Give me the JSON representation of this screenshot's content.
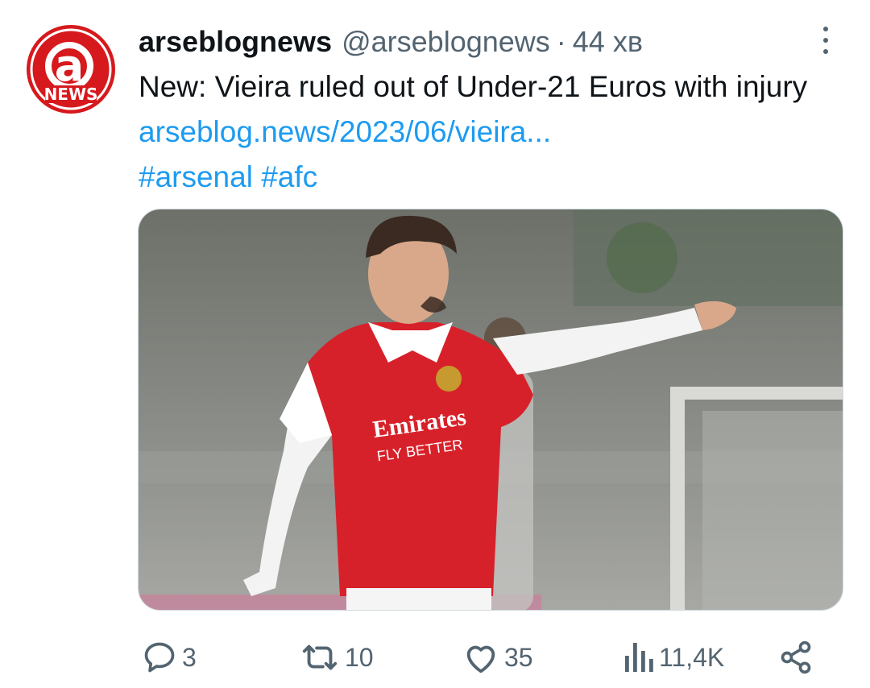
{
  "tweet": {
    "display_name": "arseblognews",
    "handle": "@arseblognews",
    "separator": "·",
    "time": "44 хв",
    "avatar": {
      "text": "NEWS",
      "logo_text": "a",
      "brand_color": "#d6191d"
    },
    "text_main": "New: Vieira ruled out of Under-21 Euros with injury",
    "link": "arseblog.news/2023/06/vieira...",
    "hashtags": [
      "#arsenal",
      "#afc"
    ],
    "media": {
      "shirt_text_1": "Emirates",
      "shirt_text_2": "FLY BETTER",
      "kit_color": "#d7212a",
      "sleeve_color": "#ffffff"
    },
    "actions": {
      "replies": "3",
      "reposts": "10",
      "likes": "35",
      "views": "11,4K"
    }
  },
  "colors": {
    "text": "#0f1419",
    "secondary": "#536471",
    "accent": "#1d9bf0"
  },
  "icons": {
    "more": "more-vertical-icon",
    "reply": "reply-bubble-icon",
    "repost": "repost-arrows-icon",
    "like": "heart-icon",
    "views": "analytics-bars-icon",
    "share": "share-nodes-icon"
  }
}
